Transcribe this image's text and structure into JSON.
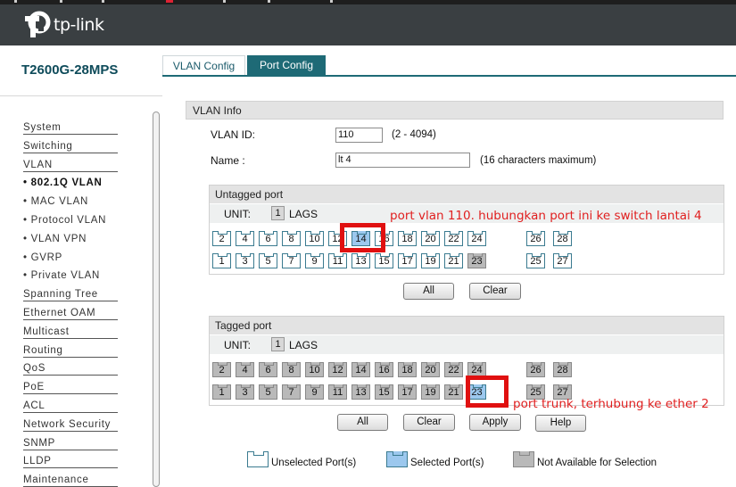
{
  "brand": {
    "logo_text": "tp-link"
  },
  "model": "T2600G-28MPS",
  "tabs": [
    {
      "label": "VLAN Config",
      "active": true
    },
    {
      "label": "Port Config",
      "active": false
    }
  ],
  "sidebar": {
    "items": [
      {
        "label": "System",
        "type": "main"
      },
      {
        "label": "Switching",
        "type": "main"
      },
      {
        "label": "VLAN",
        "type": "main"
      },
      {
        "label": "• 802.1Q VLAN",
        "type": "sub",
        "active": true
      },
      {
        "label": "• MAC VLAN",
        "type": "sub"
      },
      {
        "label": "• Protocol VLAN",
        "type": "sub"
      },
      {
        "label": "• VLAN VPN",
        "type": "sub"
      },
      {
        "label": "• GVRP",
        "type": "sub"
      },
      {
        "label": "• Private VLAN",
        "type": "sub"
      },
      {
        "label": "Spanning Tree",
        "type": "main"
      },
      {
        "label": "Ethernet OAM",
        "type": "main"
      },
      {
        "label": "Multicast",
        "type": "main"
      },
      {
        "label": "Routing",
        "type": "main"
      },
      {
        "label": "QoS",
        "type": "main"
      },
      {
        "label": "PoE",
        "type": "main"
      },
      {
        "label": "ACL",
        "type": "main"
      },
      {
        "label": "Network Security",
        "type": "main"
      },
      {
        "label": "SNMP",
        "type": "main"
      },
      {
        "label": "LLDP",
        "type": "main"
      },
      {
        "label": "Maintenance",
        "type": "main"
      }
    ]
  },
  "vlan_info": {
    "title": "VLAN Info",
    "id_label": "VLAN ID:",
    "id_value": "110",
    "id_hint": "(2 - 4094)",
    "name_label": "Name :",
    "name_value": "lt 4",
    "name_hint": "(16 characters maximum)"
  },
  "untagged": {
    "title": "Untagged port",
    "unit_label": "UNIT:",
    "unit_value": "1",
    "lags_label": "LAGS",
    "top_row": [
      "2",
      "4",
      "6",
      "8",
      "10",
      "12",
      "14",
      "16",
      "18",
      "20",
      "22",
      "24",
      "26",
      "28"
    ],
    "bottom_row": [
      "1",
      "3",
      "5",
      "7",
      "9",
      "11",
      "13",
      "15",
      "17",
      "19",
      "21",
      "23",
      "25",
      "27"
    ],
    "selected": [
      "14"
    ],
    "not_available": [
      "23"
    ],
    "buttons": {
      "all": "All",
      "clear": "Clear"
    }
  },
  "tagged": {
    "title": "Tagged port",
    "unit_label": "UNIT:",
    "unit_value": "1",
    "lags_label": "LAGS",
    "top_row": [
      "2",
      "4",
      "6",
      "8",
      "10",
      "12",
      "14",
      "16",
      "18",
      "20",
      "22",
      "24",
      "26",
      "28"
    ],
    "bottom_row": [
      "1",
      "3",
      "5",
      "7",
      "9",
      "11",
      "13",
      "15",
      "17",
      "19",
      "21",
      "23",
      "25",
      "27"
    ],
    "selected": [
      "23"
    ],
    "not_available": [
      "2",
      "4",
      "6",
      "8",
      "10",
      "12",
      "14",
      "16",
      "18",
      "20",
      "22",
      "24",
      "26",
      "28",
      "1",
      "3",
      "5",
      "7",
      "9",
      "11",
      "13",
      "15",
      "17",
      "19",
      "21",
      "25",
      "27"
    ],
    "buttons": {
      "all": "All",
      "clear": "Clear",
      "apply": "Apply",
      "help": "Help"
    }
  },
  "annotations": {
    "untagged_note": "port vlan 110. hubungkan port ini ke switch lantai 4",
    "tagged_note": "port trunk, terhubung ke ether 2"
  },
  "legend": {
    "unselected": "Unselected Port(s)",
    "selected": "Selected Port(s)",
    "not_available": "Not Available for Selection"
  },
  "colors": {
    "header_bg": "#3a3f42",
    "accent_teal": "#1e6a76",
    "selected_port": "#9cc8ee",
    "unavailable_port": "#b9b9b9",
    "annotation_red": "#e01010"
  }
}
